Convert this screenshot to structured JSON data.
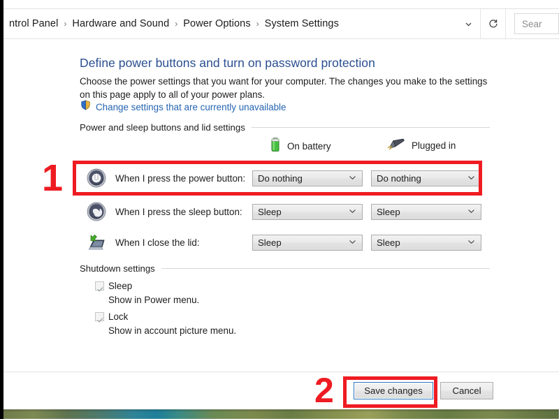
{
  "window": {
    "breadcrumb": {
      "items": [
        "ntrol Panel",
        "Hardware and Sound",
        "Power Options",
        "System Settings"
      ],
      "separator": "›"
    },
    "chevron_icon": "chevron-down-icon",
    "refresh_icon": "refresh-icon",
    "search": {
      "placeholder": "Sear"
    }
  },
  "page": {
    "title": "Define power buttons and turn on password protection",
    "description": "Choose the power settings that you want for your computer. The changes you make to the settings on this page apply to all of your power plans.",
    "uac_link": {
      "label": "Change settings that are currently unavailable",
      "icon": "shield-icon"
    }
  },
  "power_group": {
    "header": "Power and sleep buttons and lid settings",
    "columns": [
      {
        "label": "On battery",
        "icon": "battery-icon"
      },
      {
        "label": "Plugged in",
        "icon": "power-plug-icon"
      }
    ],
    "rows": [
      {
        "icon": "power-button-icon",
        "label": "When I press the power button:",
        "on_battery": "Do nothing",
        "plugged_in": "Do nothing"
      },
      {
        "icon": "sleep-moon-icon",
        "label": "When I press the sleep button:",
        "on_battery": "Sleep",
        "plugged_in": "Sleep"
      },
      {
        "icon": "laptop-lid-icon",
        "label": "When I close the lid:",
        "on_battery": "Sleep",
        "plugged_in": "Sleep"
      }
    ],
    "dropdown_caret": "∨"
  },
  "shutdown_group": {
    "header": "Shutdown settings",
    "items": [
      {
        "label": "Sleep",
        "description": "Show in Power menu.",
        "checked": true,
        "enabled": false
      },
      {
        "label": "Lock",
        "description": "Show in account picture menu.",
        "checked": true,
        "enabled": false
      }
    ]
  },
  "footer": {
    "save_label": "Save changes",
    "cancel_label": "Cancel"
  },
  "annotations": {
    "color": "#ee1c22",
    "step1": "1",
    "step2": "2"
  }
}
